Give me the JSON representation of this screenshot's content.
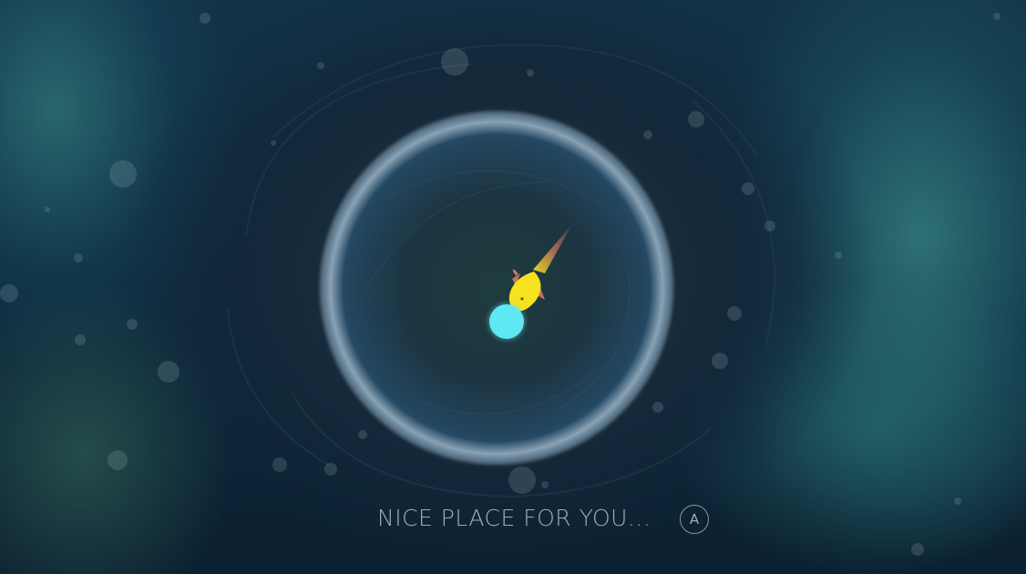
{
  "scene": {
    "caption": "NICE PLACE FOR YOU...",
    "prompt_button_label": "A",
    "player_color": "#5fe8f4",
    "creature_color": "#f6e21e",
    "creature_fin_color": "#d07a6a",
    "background_color": "#0e2a3e",
    "nebula_color": "#46aaa0",
    "planet_rim_color": "#d8e4ec"
  }
}
